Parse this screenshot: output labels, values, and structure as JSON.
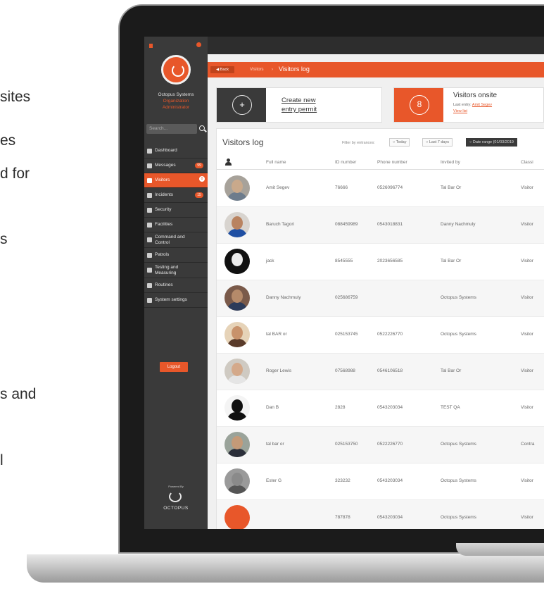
{
  "page_fragments": [
    "sites",
    "es",
    "d for",
    "s",
    "s and",
    "l"
  ],
  "colors": {
    "accent": "#e8572a",
    "sidebar": "#3a3a3a",
    "bezel": "#1b1b1b"
  },
  "sidebar": {
    "org_name": "Octopus Systems",
    "org_sub": "Organization",
    "org_role": "Administrator",
    "search_placeholder": "Search...",
    "items": [
      {
        "label": "Dashboard",
        "icon": "dashboard-icon",
        "badge": ""
      },
      {
        "label": "Messages",
        "icon": "send-icon",
        "badge": "99"
      },
      {
        "label": "Visitors",
        "icon": "visitors-icon",
        "badge": "0",
        "active": true
      },
      {
        "label": "Incidents",
        "icon": "incidents-icon",
        "badge": "15"
      },
      {
        "label": "Security",
        "icon": "shield-icon",
        "badge": ""
      },
      {
        "label": "Facilities",
        "icon": "building-icon",
        "badge": ""
      },
      {
        "label": "Command and Control",
        "icon": "eye-icon",
        "badge": ""
      },
      {
        "label": "Patrols",
        "icon": "patrol-icon",
        "badge": ""
      },
      {
        "label": "Testing and Measuring",
        "icon": "measure-icon",
        "badge": ""
      },
      {
        "label": "Routines",
        "icon": "clock-icon",
        "badge": ""
      },
      {
        "label": "System settings",
        "icon": "gear-icon",
        "badge": ""
      }
    ],
    "logout": "Logout",
    "powered_by": "Powered By",
    "powered_name": "OCTOPUS"
  },
  "breadcrumb": {
    "back": "◀ Back",
    "parent": "Visitors",
    "sep": "›",
    "current": "Visitors log"
  },
  "create_card": {
    "icon": "+",
    "label_line1": "Create new",
    "label_line2": "entry permit"
  },
  "onsite_card": {
    "count": "8",
    "title": "Visitors onsite",
    "last_entry_label": "Last entry:",
    "last_entry_name": "Amit Segev",
    "view_list": "View list"
  },
  "log": {
    "title": "Visitors log",
    "filter_label": "Filter by entrances:",
    "filters": [
      "Today",
      "Last 7 days",
      "Date range (01/03/2019"
    ],
    "columns": [
      "Full name",
      "ID number",
      "Phone number",
      "Invited by",
      "Classi"
    ],
    "rows": [
      {
        "name": "Amit Segev",
        "id": "76666",
        "phone": "0526096774",
        "invited_by": "Tal Bar Or",
        "class": "Visitor",
        "skin": "#c9a98b",
        "shirt": "#6d7c8c",
        "bg": "#a7a29a"
      },
      {
        "name": "Baruch Tagori",
        "id": "088459989",
        "phone": "0543018831",
        "invited_by": "Danny Nachmuly",
        "class": "Visitor",
        "skin": "#b98360",
        "shirt": "#1f4fa3",
        "bg": "#d8d4cf"
      },
      {
        "name": "jack",
        "id": "8545555",
        "phone": "2023656585",
        "invited_by": "Tal Bar Or",
        "class": "Visitor",
        "skin": "#ececec",
        "shirt": "#111111",
        "bg": "#111111"
      },
      {
        "name": "Danny Nachmuly",
        "id": "025686759",
        "phone": "",
        "invited_by": "Octopus Systems",
        "class": "Visitor",
        "skin": "#b58a6a",
        "shirt": "#2c3b5a",
        "bg": "#7a5a4a"
      },
      {
        "name": "tal BAR or",
        "id": "025153745",
        "phone": "0522226770",
        "invited_by": "Octopus Systems",
        "class": "Visitor",
        "skin": "#c8926b",
        "shirt": "#5a3b2a",
        "bg": "#e6d3b8"
      },
      {
        "name": "Roger Lewis",
        "id": "07568988",
        "phone": "0546106518",
        "invited_by": "Tal Bar Or",
        "class": "Visitor",
        "skin": "#d4a98a",
        "shirt": "#e5e5e5",
        "bg": "#cfcac2"
      },
      {
        "name": "Dan B",
        "id": "2828",
        "phone": "0543203034",
        "invited_by": "TEST QA",
        "class": "Visitor",
        "skin": "#111111",
        "shirt": "#111111",
        "bg": "#f4f4f4"
      },
      {
        "name": "tal bar or",
        "id": "025153750",
        "phone": "0522226770",
        "invited_by": "Octopus Systems",
        "class": "Contra",
        "skin": "#c49a78",
        "shirt": "#2b2f3a",
        "bg": "#9aa39a"
      },
      {
        "name": "Ester G",
        "id": "323232",
        "phone": "0543203034",
        "invited_by": "Octopus Systems",
        "class": "Visitor",
        "skin": "#8a8a8a",
        "shirt": "#555555",
        "bg": "#9a9a9a"
      },
      {
        "name": "",
        "id": "787878",
        "phone": "0543203034",
        "invited_by": "Octopus Systems",
        "class": "Visitor",
        "skin": "#e8572a",
        "shirt": "#e8572a",
        "bg": "#e8572a"
      }
    ]
  }
}
